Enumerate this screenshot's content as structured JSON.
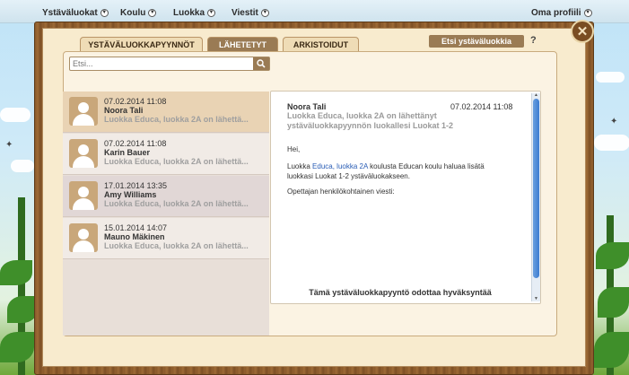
{
  "nav": {
    "items": [
      {
        "label": "Ystäväluokat"
      },
      {
        "label": "Koulu"
      },
      {
        "label": "Luokka"
      },
      {
        "label": "Viestit"
      }
    ],
    "profile": "Oma profiili"
  },
  "tabs": [
    {
      "label": "YSTÄVÄLUOKKAPYYNNÖT",
      "active": false
    },
    {
      "label": "LÄHETETYT",
      "active": true
    },
    {
      "label": "ARKISTOIDUT",
      "active": false
    }
  ],
  "search_friend_button": "Etsi ystäväluokkia",
  "help_label": "?",
  "search": {
    "placeholder": "Etsi..."
  },
  "messages": [
    {
      "date": "07.02.2014 11:08",
      "name": "Noora Tali",
      "preview": "Luokka Educa, luokka 2A on lähettä..."
    },
    {
      "date": "07.02.2014 11:08",
      "name": "Karin Bauer",
      "preview": "Luokka Educa, luokka 2A on lähettä..."
    },
    {
      "date": "17.01.2014 13:35",
      "name": "Amy Williams",
      "preview": "Luokka Educa, luokka 2A on lähettä..."
    },
    {
      "date": "15.01.2014 14:07",
      "name": "Mauno Mäkinen",
      "preview": "Luokka Educa, luokka 2A on lähettä..."
    }
  ],
  "detail": {
    "name": "Noora Tali",
    "date": "07.02.2014 11:08",
    "subject": "Luokka Educa, luokka 2A on lähettänyt ystäväluokkapyynnön luokallesi Luokat 1-2",
    "greeting": "Hei,",
    "body_prefix": "Luokka ",
    "body_link": "Educa, luokka 2A",
    "body_suffix": " koulusta Educan koulu haluaa lisätä luokkasi Luokat 1-2 ystäväluokakseen.",
    "personal_label": "Opettajan henkilökohtainen viesti:",
    "status": "Tämä ystäväluokkapyyntö odottaa hyväksyntää"
  },
  "colors": {
    "panel": "#f8ebce",
    "active_tab": "#9a7b54",
    "link": "#2a5db5"
  }
}
